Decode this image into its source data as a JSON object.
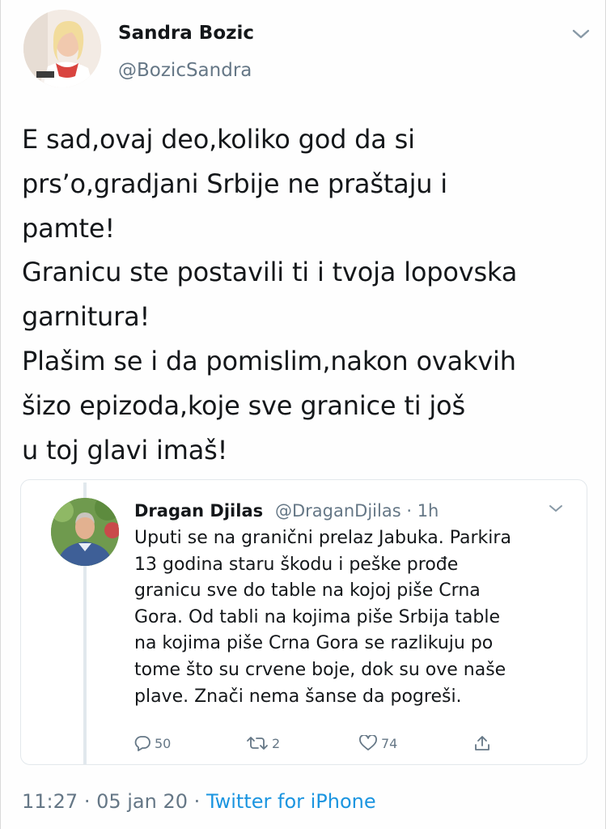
{
  "tweet": {
    "author_name": "Sandra Bozic",
    "author_handle": "@BozicSandra",
    "text": "E sad,ovaj deo,koliko god da si\nprs’o,gradjani Srbije ne praštaju i\npamte!\nGranicu ste postavili ti i tvoja lopovska\ngarnitura!\nPlašim se i da pomislim,nakon ovakvih\nšizo epizoda,koje sve granice ti još\nu toj glavi imaš!",
    "time": "11:27",
    "separator": "·",
    "date": "05 jan 20",
    "source": "Twitter for iPhone"
  },
  "quoted": {
    "author_name": "Dragan Djilas",
    "author_handle": "@DraganDjilas · 1h",
    "text": "Uputi se na granični prelaz Jabuka. Parkira\n13 godina staru škodu i peške prođe\ngranicu sve do table na kojoj piše Crna\nGora. Od tabli na kojima piše Srbija table\nna kojima piše Crna Gora se razlikuju po\ntome što su crvene boje, dok su ove naše\nplave. Znači nema šanse da pogreši.",
    "replies": "50",
    "retweets": "2",
    "likes": "74"
  },
  "icons": {
    "menu": "chevron-down-icon",
    "reply": "reply-icon",
    "retweet": "retweet-icon",
    "like": "heart-icon",
    "share": "share-icon"
  },
  "colors": {
    "text": "#14171a",
    "secondary": "#657786",
    "link": "#1b95e0",
    "border": "#e3e8ec"
  }
}
